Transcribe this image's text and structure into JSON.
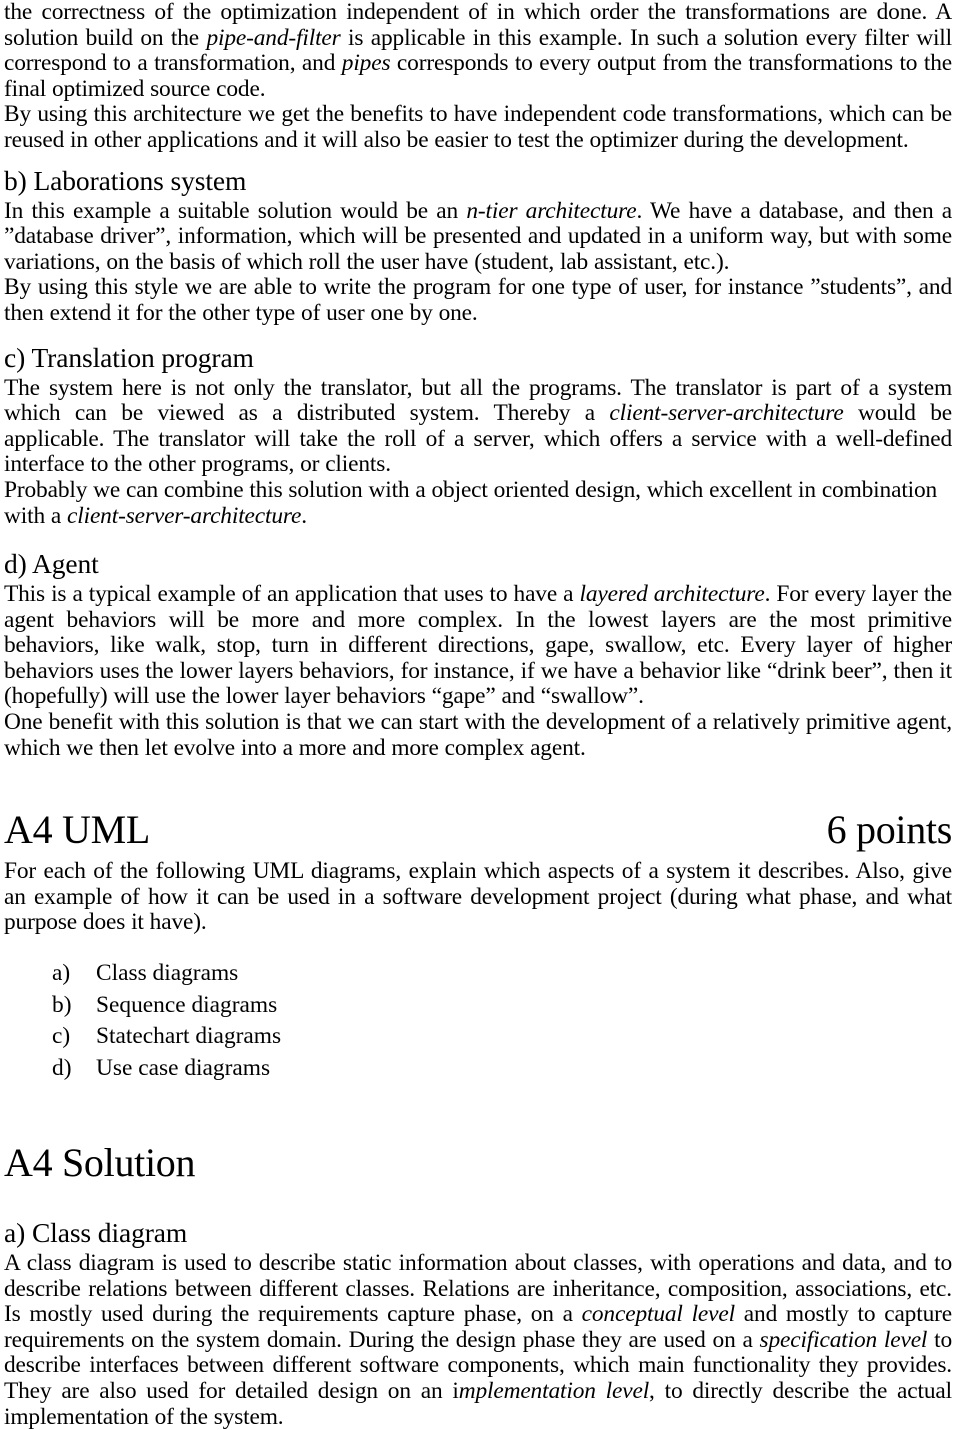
{
  "document": {
    "intro_paragraph": {
      "part1": "the correctness of the optimization independent of in which order the transformations are done. A solution build on the ",
      "italic1": "pipe-and-filter",
      "part2": " is applicable in this example. In such a solution every filter will correspond to a transformation, and ",
      "italic2": "pipes",
      "part3": " corresponds to every output from the transformations to the final optimized source code."
    },
    "intro_paragraph2": "By using this architecture we get the benefits to have independent code transformations, which can be reused in other applications and it will also be easier to test the optimizer during the development.",
    "section_b": {
      "heading": "b) Laborations system",
      "para1_part1": "In this example a suitable solution would be an ",
      "para1_italic": "n-tier architecture",
      "para1_part2": ". We have a database, and then a ”database driver”, information, which will be presented and updated in a uniform way, but with some variations, on the basis of which roll the user have (student, lab assistant, etc.).",
      "para2": "By using this style we are able to write the program for one type of user, for instance ”students”, and then extend it for the other type of user one by one."
    },
    "section_c": {
      "heading": "c) Translation program",
      "para1_part1": "The system here is not only the translator, but all the programs. The translator is part of a system which can be viewed as a distributed system. Thereby a ",
      "para1_italic": "client-server-architecture",
      "para1_part2": " would be applicable. The translator will take the roll of a server, which offers a service with a well-defined interface to the other programs, or clients.",
      "para2_part1": "Probably we can combine this solution with a object oriented design, which excellent in combination with a ",
      "para2_italic": "client-server-architecture",
      "para2_part2": "."
    },
    "section_d": {
      "heading": "d) Agent",
      "para1_part1": "This is a typical example of an application that uses to have a ",
      "para1_italic": "layered architecture",
      "para1_part2": ". For every layer the agent behaviors will be more and more complex. In the lowest layers are the most primitive behaviors, like walk, stop, turn in different directions, gape, swallow, etc. Every layer of higher behaviors uses the lower layers behaviors, for instance, if we have a behavior like “drink beer”, then it  (hopefully) will use the lower layer behaviors “gape” and “swallow”.",
      "para2": "One benefit with this solution is that we can start with the development of a relatively primitive agent, which we then let evolve into a more and more complex agent."
    },
    "section_a4_uml": {
      "title": "A4 UML",
      "points": "6 points",
      "intro": "For each of the following UML diagrams, explain which aspects of a system it describes. Also, give an example of how it can be used in a software development project (during what phase, and what purpose does it have).",
      "list": [
        {
          "mark": "a)",
          "label": "Class diagrams"
        },
        {
          "mark": "b)",
          "label": "Sequence diagrams"
        },
        {
          "mark": "c)",
          "label": "Statechart diagrams"
        },
        {
          "mark": "d)",
          "label": "Use case diagrams"
        }
      ]
    },
    "section_a4_solution": {
      "title": "A4 Solution",
      "sub_a_heading": "a) Class diagram",
      "para_part1": "A class diagram is used to describe static information about classes, with operations and data, and to describe relations between different classes. Relations are inheritance, composition, associations, etc. Is mostly used during the requirements capture phase, on a ",
      "para_italic1": "conceptual level",
      "para_part2": " and mostly to capture requirements on the system domain. During the design phase they are used on a ",
      "para_italic2": "specification level",
      "para_part3": " to describe interfaces between different software components, which main functionality they provides. They are also used for detailed design on an i",
      "para_italic3": "mplementation level",
      "para_part4": ", to directly describe the actual implementation of the system."
    }
  }
}
